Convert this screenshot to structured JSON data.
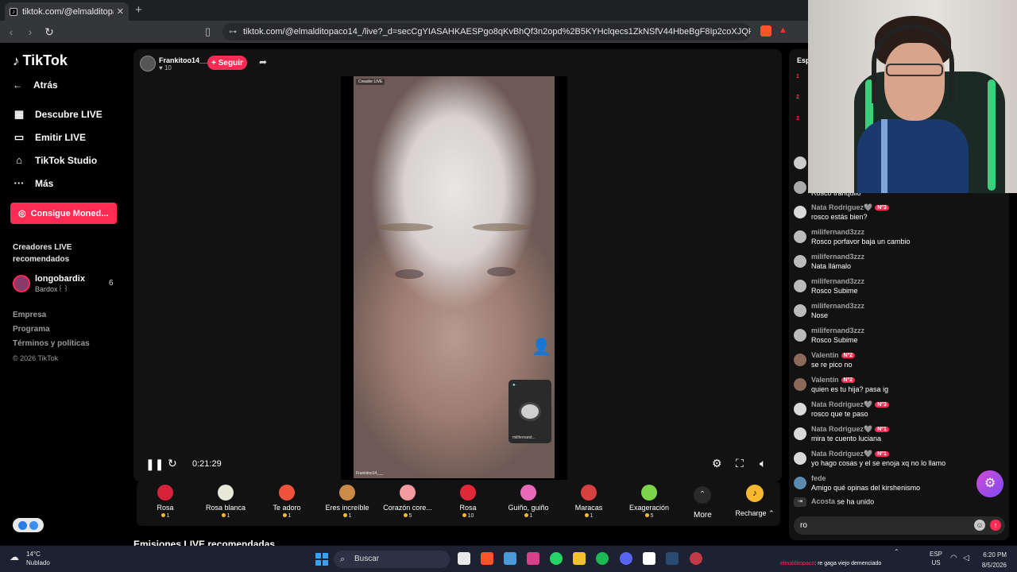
{
  "browser": {
    "tab_title": "tiktok.com/@elmalditopaco1",
    "tab_icon": "tiktok-icon",
    "tab_close": "✕",
    "new_tab": "+",
    "url": "tiktok.com/@elmalditopaco14_/live?_d=secCgYIASAHKAESPgo8qKvBhQf3n2opd%2B5KYHclqecs1ZkNSfV44HbeBgF8Ip2coXJQFhgAsvkkpUjEZaVP4MPOl..."
  },
  "sidebar": {
    "logo": "TikTok",
    "back_label": "Atrás",
    "nav": [
      {
        "label": "Descubre LIVE",
        "icon": "discover-icon"
      },
      {
        "label": "Emitir LIVE",
        "icon": "camera-icon"
      },
      {
        "label": "TikTok Studio",
        "icon": "studio-icon"
      },
      {
        "label": "Más",
        "icon": "more-icon"
      }
    ],
    "coins_button": "Consigue Moned...",
    "recommended_title": "Creadores LIVE recomendados",
    "creator": {
      "name": "longobardix",
      "sub": "Bardox꒰꒱",
      "count": "6"
    },
    "footer": [
      "Empresa",
      "Programa",
      "Términos y políticas"
    ],
    "copyright": "© 2026 TikTok"
  },
  "live": {
    "host_name": "Frankitoo14___",
    "host_likes": "10",
    "follow_label": "+ Seguir",
    "video_tag": "Creador LIVE",
    "video_bottom_tag": "Frankitoo14___",
    "pip_label": "milifernand...",
    "time": "0:21:29"
  },
  "gifts": [
    {
      "name": "Rosa",
      "price": "1",
      "color": "#d8223a"
    },
    {
      "name": "Rosa blanca",
      "price": "1",
      "color": "#e8e8d8"
    },
    {
      "name": "Te adoro",
      "price": "1",
      "color": "#f0533c"
    },
    {
      "name": "Eres increíble",
      "price": "1",
      "color": "#c98a4a"
    },
    {
      "name": "Corazón core...",
      "price": "5",
      "color": "#f29aa0"
    },
    {
      "name": "Rosa",
      "price": "10",
      "color": "#e02838"
    },
    {
      "name": "Guiño, guiño",
      "price": "1",
      "color": "#e86ab8"
    },
    {
      "name": "Maracas",
      "price": "1",
      "color": "#d84040"
    },
    {
      "name": "Exageración",
      "price": "5",
      "color": "#7bd44a"
    }
  ],
  "gift_more": "More",
  "recharge": "Recharge",
  "section_title": "Emisiones LIVE recomendadas",
  "ranking": {
    "head": "Esp",
    "ranks": [
      "1",
      "2",
      "3"
    ]
  },
  "chat": {
    "partial": "Rosco tranquilo",
    "messages": [
      {
        "user": "Nata Rodriguez🩶",
        "badge": "Nº3",
        "text": "rosco estás bien?"
      },
      {
        "user": "milifernand3zzz",
        "badge": "",
        "text": "Rosco porfavor baja un cambio"
      },
      {
        "user": "milifernand3zzz",
        "badge": "",
        "text": "Nata llámalo"
      },
      {
        "user": "milifernand3zzz",
        "badge": "",
        "text": "Rosco Subime"
      },
      {
        "user": "milifernand3zzz",
        "badge": "",
        "text": "Nose"
      },
      {
        "user": "milifernand3zzz",
        "badge": "",
        "text": "Rosco Subime"
      },
      {
        "user": "Valentín",
        "badge": "Nº2",
        "text": "se re pico no"
      },
      {
        "user": "Valentín",
        "badge": "Nº2",
        "text": "quien es tu hija? pasa ig"
      },
      {
        "user": "Nata Rodriguez🩶",
        "badge": "Nº3",
        "text": "rosco que te paso"
      },
      {
        "user": "Nata Rodriguez🩶",
        "badge": "Nº1",
        "text": "mira te cuento luciana"
      },
      {
        "user": "Nata Rodriguez🩶",
        "badge": "Nº1",
        "text": "yo hago cosas y el se enoja xq no lo llamo"
      },
      {
        "user": "fede",
        "badge": "",
        "text": "Amigo qué opinas del kirshenismo"
      }
    ],
    "joined_user": "Acosta",
    "joined_text": "se ha unido",
    "input_value": "ro"
  },
  "taskbar": {
    "temp": "14°C",
    "weather": "Nublado",
    "search": "Buscar",
    "ticker_user": "elmalditopaco",
    "ticker_text": ": re gaga viejo demenciado",
    "lang1": "ESP",
    "lang2": "US",
    "time": "6:20 PM",
    "date": "8/5/2026"
  }
}
